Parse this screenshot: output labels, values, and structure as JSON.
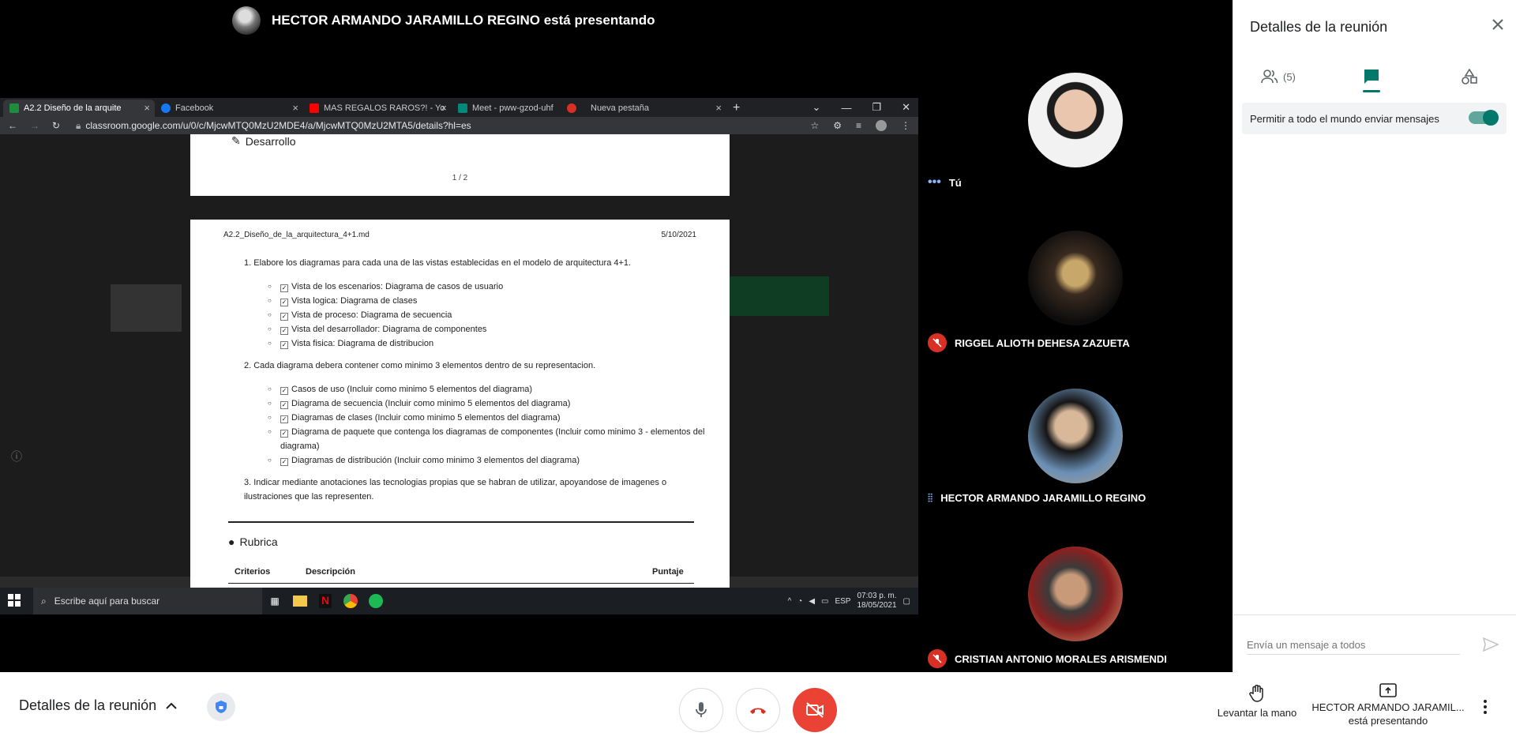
{
  "presenter_banner": {
    "text": "HECTOR ARMANDO JARAMILLO REGINO está presentando"
  },
  "browser": {
    "tabs": [
      {
        "label": "A2.2 Diseño de la arquite",
        "active": true,
        "color": "#1e8e3e"
      },
      {
        "label": "Facebook",
        "active": false,
        "color": "#1877f2"
      },
      {
        "label": "MAS REGALOS RAROS?! - Yo",
        "active": false,
        "color": "#ff0000"
      },
      {
        "label": "Meet - pww-gzod-uhf",
        "active": false,
        "color": "#00897b"
      },
      {
        "label": "",
        "active": false,
        "color": "#d93025"
      },
      {
        "label": "Nueva pestaña",
        "active": false,
        "color": "#5f6368"
      }
    ],
    "new_tab": "+",
    "url": "classroom.google.com/u/0/c/MjcwMTQ0MzU2MDE4/a/MjcwMTQ0MzU2MTA5/details?hl=es"
  },
  "pdf": {
    "page1": {
      "heading": "Desarrollo",
      "page_num": "1 / 2"
    },
    "page2": {
      "file": "A2.2_Diseño_de_la_arquitectura_4+1.md",
      "date": "5/10/2021",
      "item1": "1. Elabore los diagramas para cada una de las vistas establecidas en el modelo de arquitectura 4+1.",
      "list1": [
        "Vista de los escenarios: Diagrama de casos de usuario",
        "Vista logica: Diagrama de clases",
        "Vista de proceso: Diagrama de secuencia",
        "Vista del desarrollador: Diagrama de componentes",
        "Vista fisica: Diagrama de distribucion"
      ],
      "item2": "2. Cada diagrama debera contener como minimo 3 elementos dentro de su representacion.",
      "list2": [
        "Casos de uso (Incluir como minimo 5 elementos del diagrama)",
        "Diagrama de secuencia (Incluir como minimo 5 elementos del diagrama)",
        "Diagramas de clases (Incluir como minimo 5 elementos del diagrama)",
        "Diagrama de paquete que contenga los diagramas de componentes (Incluir como minimo 3 - elementos del diagrama)",
        "Diagramas de distribución (Incluir como minimo 3 elementos del diagrama)"
      ],
      "item3": "3. Indicar mediante anotaciones las tecnologias propias que se habran de utilizar, apoyandose de imagenes o ilustraciones que las representen.",
      "section": "Rubrica",
      "table_headers": [
        "Criterios",
        "Descripción",
        "Puntaje"
      ]
    }
  },
  "taskbar": {
    "search_placeholder": "Escribe aquí para buscar",
    "lang": "ESP",
    "time": "07:03 p. m.",
    "date": "18/05/2021"
  },
  "participants": [
    {
      "name": "Tú",
      "muted": false,
      "speaking": false,
      "self": true
    },
    {
      "name": "RIGGEL ALIOTH DEHESA ZAZUETA",
      "muted": true
    },
    {
      "name": "HECTOR ARMANDO JARAMILLO REGINO",
      "muted": false,
      "speaking": true
    },
    {
      "name": "CRISTIAN ANTONIO MORALES ARISMENDI",
      "muted": true
    }
  ],
  "panel": {
    "title": "Detalles de la reunión",
    "people_count": "(5)",
    "permission_label": "Permitir a todo el mundo enviar mensajes",
    "permission_on": true,
    "message_placeholder": "Envía un mensaje a todos"
  },
  "bottom": {
    "details_label": "Detalles de la reunión",
    "raise_hand": "Levantar la mano",
    "presenter_line1": "HECTOR ARMANDO JARAMIL...",
    "presenter_line2": "está presentando"
  },
  "colors": {
    "accent": "#00796b",
    "danger": "#ea4335",
    "muted_red": "#d93025"
  }
}
